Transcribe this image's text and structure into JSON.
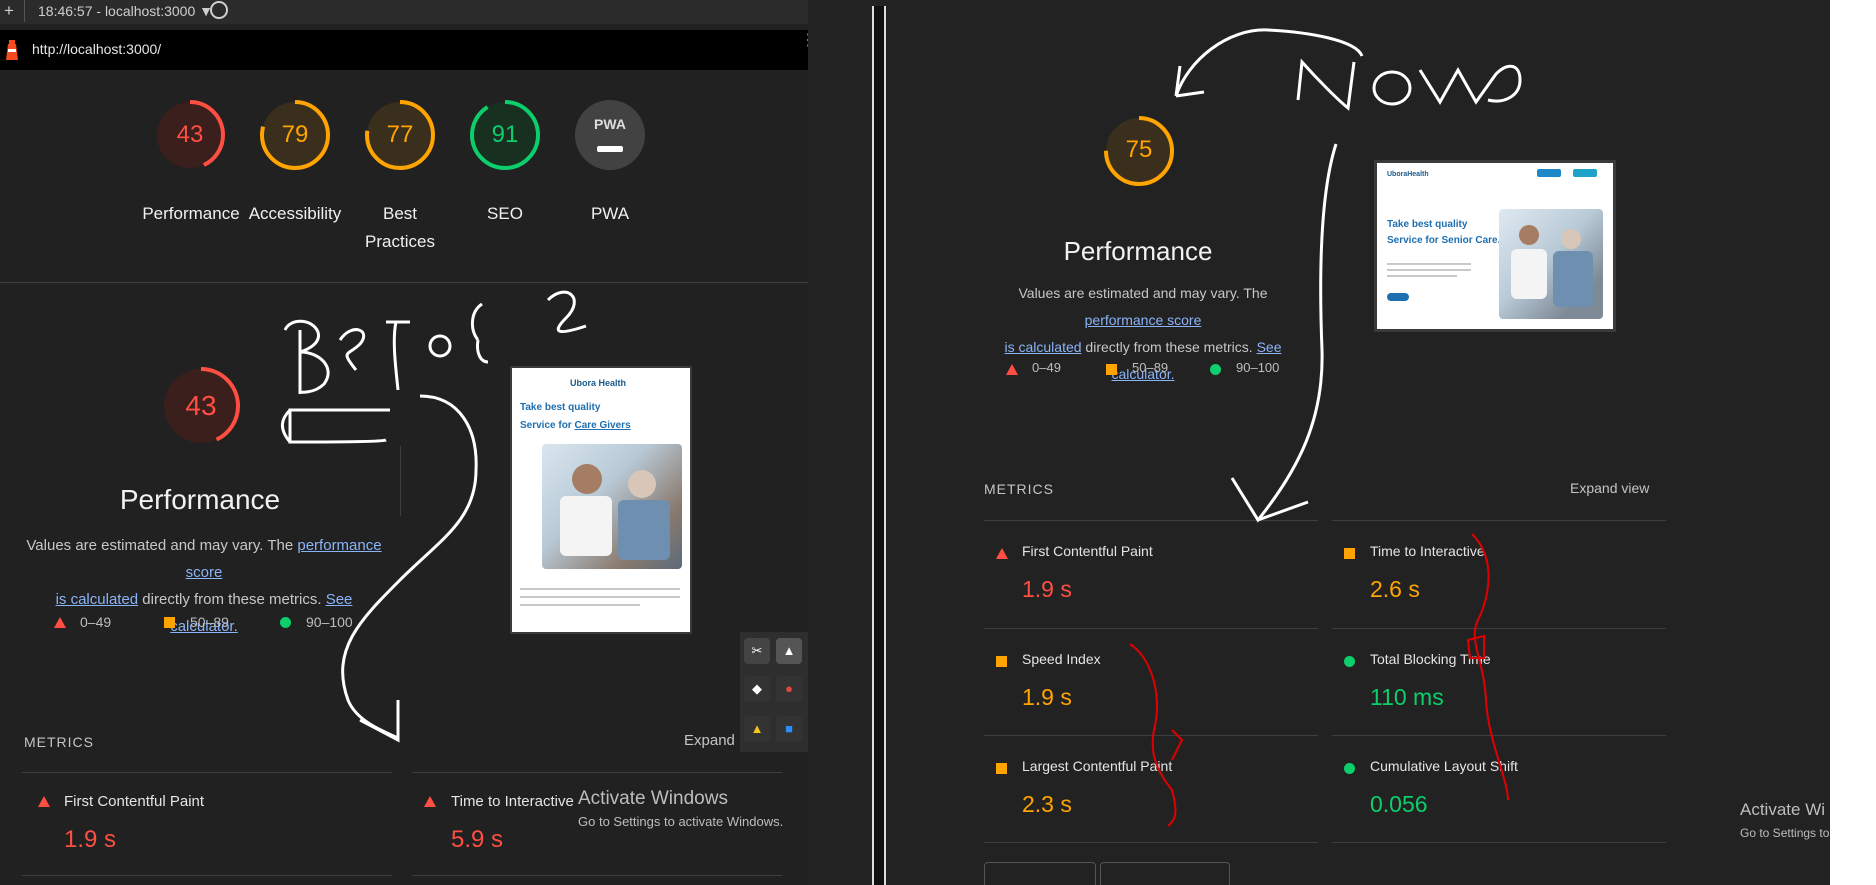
{
  "left": {
    "topbar": {
      "time_host": "18:46:57 - localhost:3000 ▼",
      "plus": "+"
    },
    "url": "http://localhost:3000/",
    "scores": [
      {
        "value": "43",
        "label": "Performance",
        "color": "#ff4e42",
        "score": 0.43
      },
      {
        "value": "79",
        "label": "Accessibility",
        "color": "#ffa400",
        "score": 0.79
      },
      {
        "value": "77",
        "label": "Best Practices",
        "label_line1": "Best",
        "label_line2": "Practices",
        "color": "#ffa400",
        "score": 0.77
      },
      {
        "value": "91",
        "label": "SEO",
        "color": "#0cce6b",
        "score": 0.91
      },
      {
        "value": "PWA",
        "label": "PWA",
        "color": "#9e9e9e"
      }
    ],
    "perf": {
      "score": "43",
      "title": "Performance",
      "desc_pre": "Values are estimated and may vary. The ",
      "desc_link1": "performance score",
      "desc_link1b": "is calculated",
      "desc_mid": " directly from these metrics. ",
      "desc_link2": "See calculator."
    },
    "legend": [
      "0–49",
      "50–89",
      "90–100"
    ],
    "metrics_title": "METRICS",
    "expand": "Expand",
    "metrics": [
      {
        "label": "First Contentful Paint",
        "value": "1.9 s"
      },
      {
        "label": "Time to Interactive",
        "value": "5.9 s"
      }
    ],
    "thumb": {
      "brand": "Ubora Health",
      "headline1": "Take best quality",
      "headline2_pre": "Service for ",
      "headline2_link": "Care Givers"
    },
    "annotation": "Before",
    "watermark": {
      "title": "Activate Windows",
      "sub": "Go to Settings to activate Windows."
    }
  },
  "right": {
    "perf": {
      "score": "75",
      "title": "Performance",
      "desc_pre": "Values are estimated and may vary. The ",
      "desc_link1": "performance score",
      "desc_link1b": "is calculated",
      "desc_mid": " directly from these metrics. ",
      "desc_link2": "See calculator."
    },
    "legend": [
      "0–49",
      "50–89",
      "90–100"
    ],
    "metrics_title": "METRICS",
    "expand": "Expand view",
    "metrics": [
      {
        "label": "First Contentful Paint",
        "value": "1.9 s",
        "status": "red"
      },
      {
        "label": "Time to Interactive",
        "value": "2.6 s",
        "status": "orange"
      },
      {
        "label": "Speed Index",
        "value": "1.9 s",
        "status": "orange"
      },
      {
        "label": "Total Blocking Time",
        "value": "110 ms",
        "status": "green"
      },
      {
        "label": "Largest Contentful Paint",
        "value": "2.3 s",
        "status": "orange"
      },
      {
        "label": "Cumulative Layout Shift",
        "value": "0.056",
        "status": "green"
      }
    ],
    "thumb": {
      "brand": "UboraHealth",
      "headline1": "Take best quality",
      "headline2_pre": "Service for ",
      "headline2_link": "Senior Care."
    },
    "annotation": "Now",
    "watermark": {
      "title": "Activate Wi",
      "sub": "Go to Settings to"
    }
  }
}
